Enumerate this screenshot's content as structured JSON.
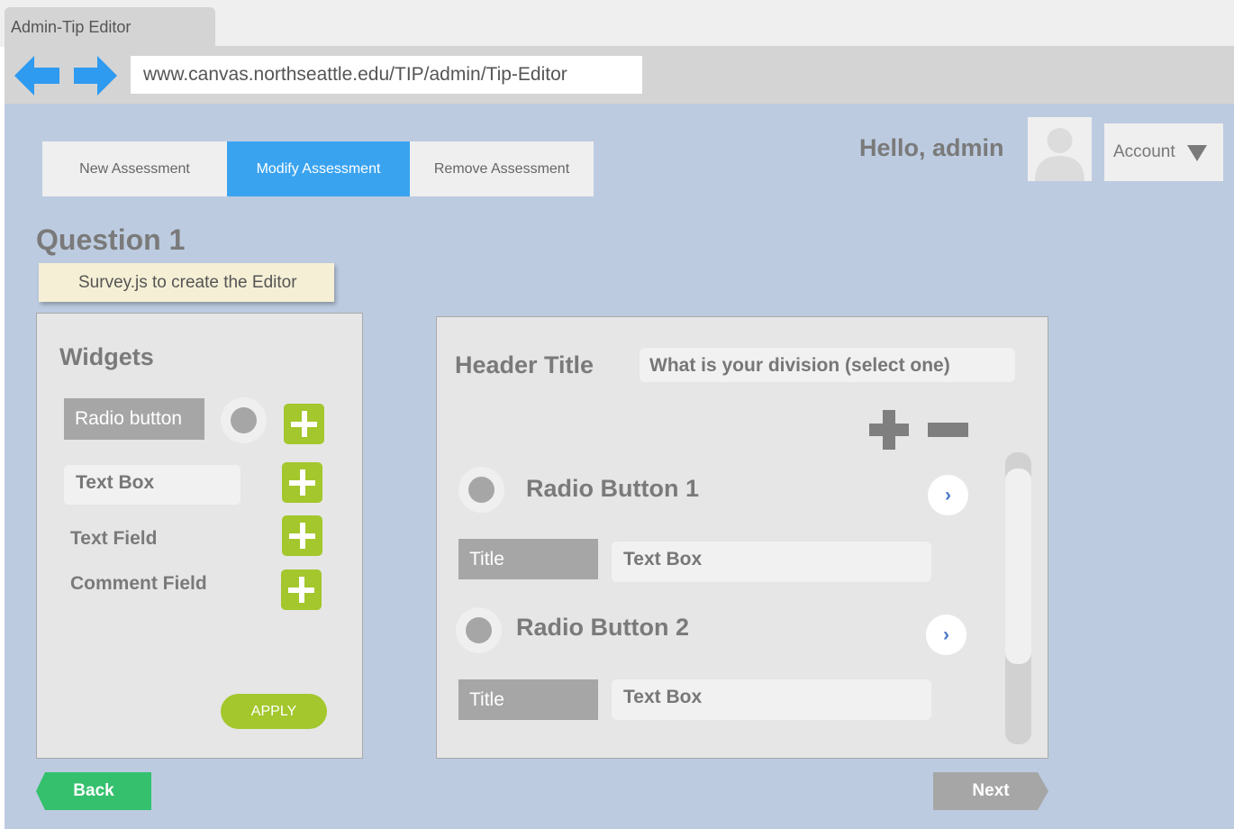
{
  "browser": {
    "tab_title": "Admin-Tip Editor",
    "url": "www.canvas.northseattle.edu/TIP/admin/Tip-Editor",
    "arrow_color": "#2e9af0"
  },
  "nav": {
    "tabs": [
      {
        "label": "New Assessment",
        "active": false
      },
      {
        "label": "Modify Assessment",
        "active": true
      },
      {
        "label": "Remove Assessment",
        "active": false
      }
    ]
  },
  "user": {
    "greeting": "Hello, admin",
    "account_label": "Account"
  },
  "question": {
    "title": "Question 1",
    "note": "Survey.js to create the Editor"
  },
  "widgets": {
    "title": "Widgets",
    "items": [
      {
        "label": "Radio button"
      },
      {
        "label": "Text Box"
      },
      {
        "label": "Text Field"
      },
      {
        "label": "Comment Field"
      }
    ],
    "apply_label": "APPLY"
  },
  "editor": {
    "header_label": "Header Title",
    "header_value": "What is your division (select one)",
    "options": [
      {
        "label": "Radio Button 1",
        "title_label": "Title",
        "text_box": "Text Box"
      },
      {
        "label": "Radio Button 2",
        "title_label": "Title",
        "text_box": "Text Box"
      }
    ]
  },
  "footer": {
    "back_label": "Back",
    "next_label": "Next"
  },
  "colors": {
    "page_bg": "#bccbe0",
    "accent_blue": "#3aa3f0",
    "accent_green": "#a3c72c",
    "back_green": "#34c06d",
    "next_gray": "#a6a6a6"
  }
}
